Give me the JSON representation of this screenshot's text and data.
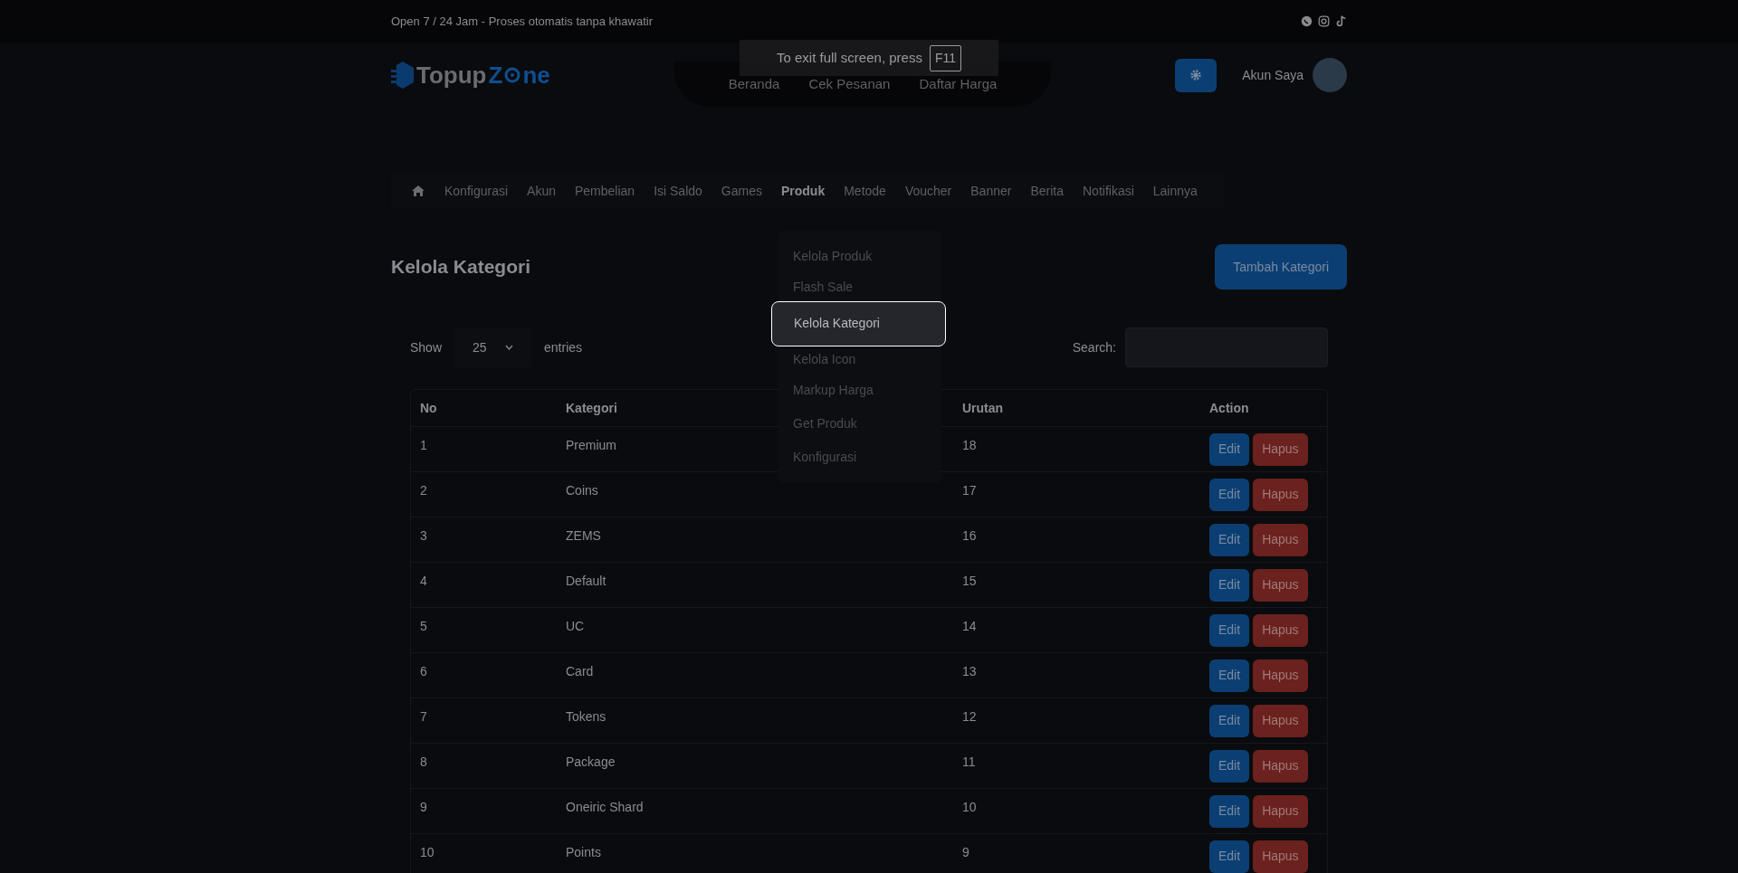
{
  "top_bar": {
    "text": "Open 7 / 24 Jam - Proses otomatis tanpa khawatir"
  },
  "header": {
    "logo": {
      "part_1": "Topup",
      "part_2": "Z",
      "part_3": "ne"
    },
    "nav": [
      "Beranda",
      "Cek Pesanan",
      "Daftar Harga"
    ],
    "account": "Akun Saya"
  },
  "fullscreen_toast": {
    "text": "To exit full screen, press",
    "key": "F11"
  },
  "admin_menu": [
    {
      "label": "Konfigurasi",
      "selected": false
    },
    {
      "label": "Akun",
      "selected": false
    },
    {
      "label": "Pembelian",
      "selected": false
    },
    {
      "label": "Isi Saldo",
      "selected": false
    },
    {
      "label": "Games",
      "selected": false
    },
    {
      "label": "Produk",
      "selected": true
    },
    {
      "label": "Metode",
      "selected": false
    },
    {
      "label": "Voucher",
      "selected": false
    },
    {
      "label": "Banner",
      "selected": false
    },
    {
      "label": "Berita",
      "selected": false
    },
    {
      "label": "Notifikasi",
      "selected": false
    },
    {
      "label": "Lainnya",
      "selected": false
    }
  ],
  "dropdown": [
    {
      "label": "Kelola Produk",
      "selected": false
    },
    {
      "label": "Flash Sale",
      "selected": false
    },
    {
      "label": "Kelola Kategori",
      "selected": true
    },
    {
      "label": "Kelola Icon",
      "selected": false
    },
    {
      "label": "Markup Harga",
      "selected": false
    },
    {
      "label": "Get Produk",
      "selected": false
    },
    {
      "label": "Konfigurasi",
      "selected": false
    }
  ],
  "page_title": "Kelola Kategori",
  "add_button": "Tambah Kategori",
  "table_controls": {
    "show_label": "Show",
    "entries_value": "25",
    "entries_label": "entries",
    "search_label": "Search:"
  },
  "table": {
    "columns": [
      "No",
      "Kategori",
      "Urutan",
      "Action"
    ],
    "rows": [
      {
        "no": "1",
        "kategori": "Premium",
        "urutan": "18",
        "edit": "Edit",
        "delete": "Hapus"
      },
      {
        "no": "2",
        "kategori": "Coins",
        "urutan": "17",
        "edit": "Edit",
        "delete": "Hapus"
      },
      {
        "no": "3",
        "kategori": "ZEMS",
        "urutan": "16",
        "edit": "Edit",
        "delete": "Hapus"
      },
      {
        "no": "4",
        "kategori": "Default",
        "urutan": "15",
        "edit": "Edit",
        "delete": "Hapus"
      },
      {
        "no": "5",
        "kategori": "UC",
        "urutan": "14",
        "edit": "Edit",
        "delete": "Hapus"
      },
      {
        "no": "6",
        "kategori": "Card",
        "urutan": "13",
        "edit": "Edit",
        "delete": "Hapus"
      },
      {
        "no": "7",
        "kategori": "Tokens",
        "urutan": "12",
        "edit": "Edit",
        "delete": "Hapus"
      },
      {
        "no": "8",
        "kategori": "Package",
        "urutan": "11",
        "edit": "Edit",
        "delete": "Hapus"
      },
      {
        "no": "9",
        "kategori": "Oneiric Shard",
        "urutan": "10",
        "edit": "Edit",
        "delete": "Hapus"
      },
      {
        "no": "10",
        "kategori": "Points",
        "urutan": "9",
        "edit": "Edit",
        "delete": "Hapus"
      }
    ]
  }
}
